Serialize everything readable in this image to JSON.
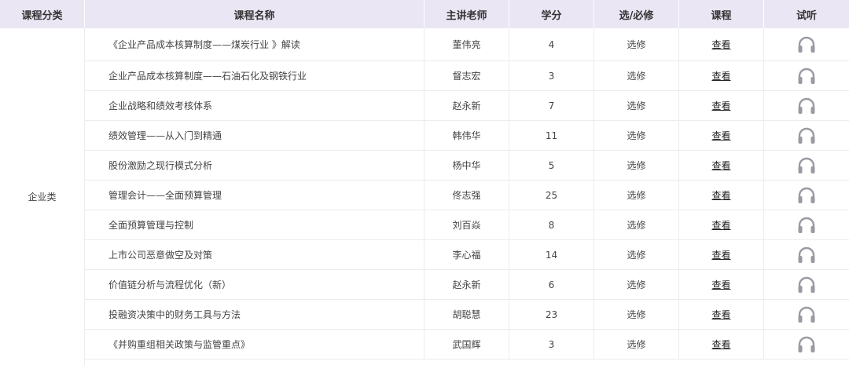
{
  "header": {
    "category": "课程分类",
    "name": "课程名称",
    "teacher": "主讲老师",
    "credit": "学分",
    "type": "选/必修",
    "course": "课程",
    "listen": "试听"
  },
  "category_label": "企业类",
  "rows": [
    {
      "name": "《企业产品成本核算制度——煤炭行业 》解读",
      "teacher": "董伟亮",
      "credit": "4",
      "type": "选修",
      "view": "查看",
      "icon": "headphones-icon"
    },
    {
      "name": "企业产品成本核算制度——石油石化及钢铁行业",
      "teacher": "督志宏",
      "credit": "3",
      "type": "选修",
      "view": "查看",
      "icon": "headphones-icon"
    },
    {
      "name": "企业战略和绩效考核体系",
      "teacher": "赵永新",
      "credit": "7",
      "type": "选修",
      "view": "查看",
      "icon": "headphones-icon"
    },
    {
      "name": "绩效管理——从入门到精通",
      "teacher": "韩伟华",
      "credit": "11",
      "type": "选修",
      "view": "查看",
      "icon": "headphones-icon"
    },
    {
      "name": "股份激励之现行模式分析",
      "teacher": "杨中华",
      "credit": "5",
      "type": "选修",
      "view": "查看",
      "icon": "headphones-icon"
    },
    {
      "name": "管理会计——全面预算管理",
      "teacher": "佟志强",
      "credit": "25",
      "type": "选修",
      "view": "查看",
      "icon": "headphones-icon"
    },
    {
      "name": "全面预算管理与控制",
      "teacher": "刘百焱",
      "credit": "8",
      "type": "选修",
      "view": "查看",
      "icon": "headphones-icon"
    },
    {
      "name": "上市公司恶意做空及对策",
      "teacher": "李心福",
      "credit": "14",
      "type": "选修",
      "view": "查看",
      "icon": "headphones-icon"
    },
    {
      "name": "价值链分析与流程优化（新）",
      "teacher": "赵永新",
      "credit": "6",
      "type": "选修",
      "view": "查看",
      "icon": "headphones-icon"
    },
    {
      "name": "投融资决策中的财务工具与方法",
      "teacher": "胡聪慧",
      "credit": "23",
      "type": "选修",
      "view": "查看",
      "icon": "headphones-icon"
    },
    {
      "name": "《并购重组相关政策与监管重点》",
      "teacher": "武国辉",
      "credit": "3",
      "type": "选修",
      "view": "查看",
      "icon": "headphones-icon"
    }
  ],
  "colors": {
    "header_bg": "#eae6f4",
    "icon": "#9a9aa3",
    "border": "#ececec"
  }
}
